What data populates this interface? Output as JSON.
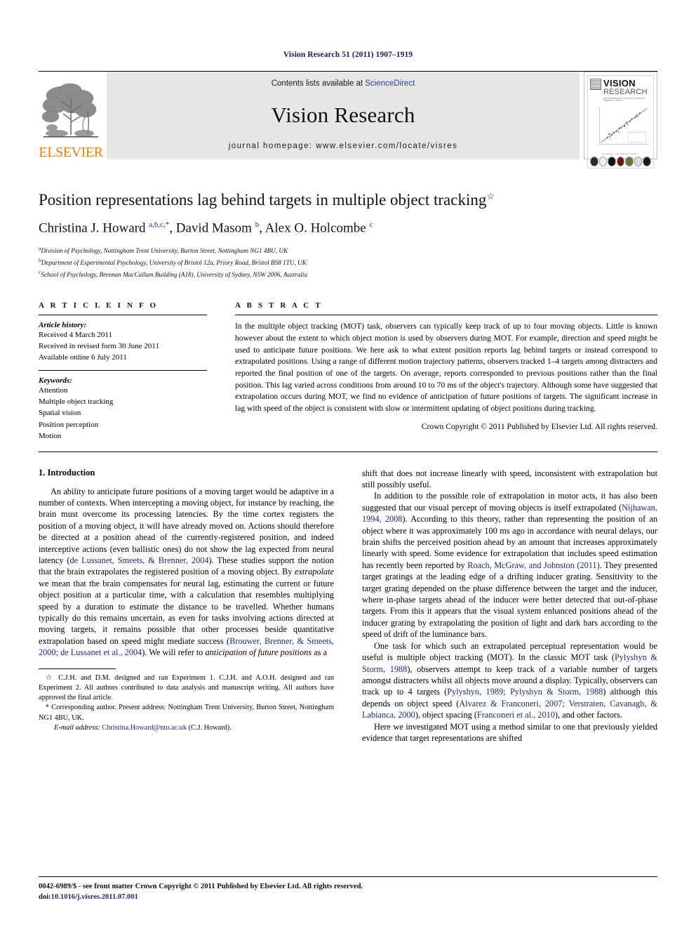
{
  "running_head": "Vision Research 51 (2011) 1907–1919",
  "masthead": {
    "publisher_logo_text": "ELSEVIER",
    "contents_prefix": "Contents lists available at ",
    "contents_link": "ScienceDirect",
    "journal_title": "Vision Research",
    "homepage": "journal homepage: www.elsevier.com/locate/visres",
    "cover": {
      "title_top": "VISION",
      "title_bottom": "RESEARCH",
      "subtitle": "an international journal for functional aspects of vision",
      "caption": "Special Issue  ·  Vision Research  ·  Volume 51",
      "publisher_mark_name": "elsevier-tree-mark"
    }
  },
  "article": {
    "title": "Position representations lag behind targets in multiple object tracking",
    "title_footnote_marker": "☆",
    "authors_html": "Christina J. Howard <sup>a,b,c,*</sup>, David Masom <sup>b</sup>, Alex O. Holcombe <sup>c</sup>",
    "affiliations": [
      {
        "marker": "a",
        "text": "Division of Psychology, Nottingham Trent University, Burton Street, Nottingham NG1 4BU, UK"
      },
      {
        "marker": "b",
        "text": "Department of Experimental Psychology, University of Bristol 12a, Priory Road, Bristol BS8 1TU, UK"
      },
      {
        "marker": "c",
        "text": "School of Psychology, Brennan MacCallum Building (A18), University of Sydney, NSW 2006, Australia"
      }
    ]
  },
  "article_info": {
    "heading": "A R T I C L E   I N F O",
    "history_label": "Article history:",
    "history": [
      "Received 4 March 2011",
      "Received in revised form 30 June 2011",
      "Available online 6 July 2011"
    ],
    "keywords_label": "Keywords:",
    "keywords": [
      "Attention",
      "Multiple object tracking",
      "Spatial vision",
      "Position perception",
      "Motion"
    ]
  },
  "abstract": {
    "heading": "A B S T R A C T",
    "text": "In the multiple object tracking (MOT) task, observers can typically keep track of up to four moving objects. Little is known however about the extent to which object motion is used by observers during MOT. For example, direction and speed might be used to anticipate future positions. We here ask to what extent position reports lag behind targets or instead correspond to extrapolated positions. Using a range of different motion trajectory patterns, observers tracked 1–4 targets among distracters and reported the final position of one of the targets. On average, reports corresponded to previous positions rather than the final position. This lag varied across conditions from around 10 to 70 ms of the object's trajectory. Although some have suggested that extrapolation occurs during MOT, we find no evidence of anticipation of future positions of targets. The significant increase in lag with speed of the object is consistent with slow or intermittent updating of object positions during tracking.",
    "copyright": "Crown Copyright © 2011 Published by Elsevier Ltd. All rights reserved."
  },
  "body": {
    "section_title": "1. Introduction",
    "left_paragraphs": [
      "An ability to anticipate future positions of a moving target would be adaptive in a number of contexts. When intercepting a moving object, for instance by reaching, the brain must overcome its processing latencies. By the time cortex registers the position of a moving object, it will have already moved on. Actions should therefore be directed at a position ahead of the currently-registered position, and indeed interceptive actions (even ballistic ones) do not show the lag expected from neural latency (de Lussanet, Smeets, & Brenner, 2004). These studies support the notion that the brain extrapolates the registered position of a moving object. By extrapolate we mean that the brain compensates for neural lag, estimating the current or future object position at a particular time, with a calculation that resembles multiplying speed by a duration to estimate the distance to be travelled. Whether humans typically do this remains uncertain, as even for tasks involving actions directed at moving targets, it remains possible that other processes beside quantitative extrapolation based on speed might mediate success (Brouwer, Brenner, & Smeets, 2000; de Lussanet et al., 2004). We will refer to anticipation of future positions as a"
    ],
    "right_paragraphs": [
      "shift that does not increase linearly with speed, inconsistent with extrapolation but still possibly useful.",
      "In addition to the possible role of extrapolation in motor acts, it has also been suggested that our visual percept of moving objects is itself extrapolated (Nijhawan, 1994, 2008). According to this theory, rather than representing the position of an object where it was approximately 100 ms ago in accordance with neural delays, our brain shifts the perceived position ahead by an amount that increases approximately linearly with speed. Some evidence for extrapolation that includes speed estimation has recently been reported by Roach, McGraw, and Johnston (2011). They presented target gratings at the leading edge of a drifting inducer grating. Sensitivity to the target grating depended on the phase difference between the target and the inducer, where in-phase targets ahead of the inducer were better detected that out-of-phase targets. From this it appears that the visual system enhanced positions ahead of the inducer grating by extrapolating the position of light and dark bars according to the speed of drift of the luminance bars.",
      "One task for which such an extrapolated perceptual representation would be useful is multiple object tracking (MOT). In the classic MOT task (Pylyshyn & Storm, 1988), observers attempt to keep track of a variable number of targets amongst distracters whilst all objects move around a display. Typically, observers can track up to 4 targets (Pylyshyn, 1989; Pylyshyn & Storm, 1988) although this depends on object speed (Alvarez & Franconeri, 2007; Verstraten, Cavanagh, & Labianca, 2000), object spacing (Franconeri et al., 2010), and other factors.",
      "Here we investigated MOT using a method similar to one that previously yielded evidence that target representations are shifted"
    ]
  },
  "footnotes": {
    "contribution": "C.J.H. and D.M. designed and ran Experiment 1. C.J.H. and A.O.H. designed and ran Experiment 2. All authors contributed to data analysis and manuscript writing. All authors have approved the final article.",
    "contribution_marker": "☆",
    "corresponding_marker": "*",
    "corresponding": "Corresponding author. Present address: Nottingham Trent University, Burton Street, Nottingham NG1 4BU, UK.",
    "email_label": "E-mail address:",
    "email": "Christina.Howard@ntu.ac.uk",
    "email_owner": "(C.J. Howard)."
  },
  "page_footer": {
    "issn_line": "0042-6989/$ - see front matter Crown Copyright © 2011 Published by Elsevier Ltd. All rights reserved.",
    "doi_label": "doi:",
    "doi": "10.1016/j.visres.2011.07.001"
  },
  "colors": {
    "link_blue": "#1b2a7a",
    "sciencedirect_blue": "#2b3d9e",
    "elsevier_orange": "#f07f13",
    "masthead_gray": "#e6e6e6"
  }
}
